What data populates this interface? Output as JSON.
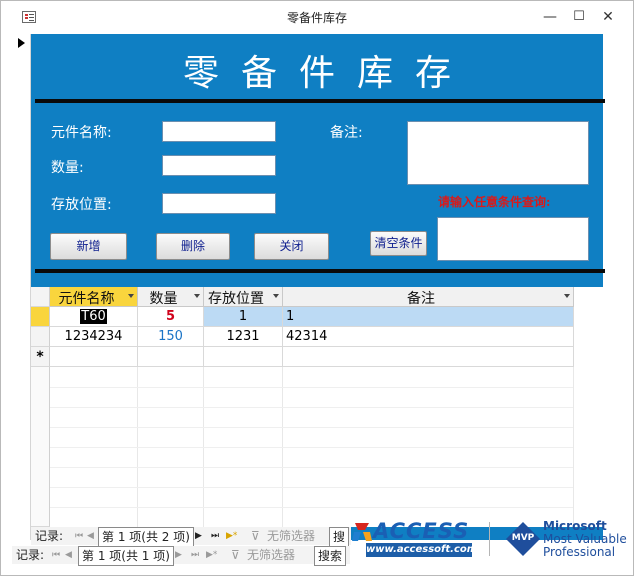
{
  "window": {
    "title": "零备件库存",
    "minimize": "—",
    "maximize": "☐",
    "close": "✕"
  },
  "form": {
    "heading": "零备件库存",
    "labels": {
      "name": "元件名称:",
      "quantity": "数量:",
      "location": "存放位置:",
      "remark": "备注:"
    },
    "inputs": {
      "name": "",
      "quantity": "",
      "location": "",
      "remark": "",
      "query": ""
    },
    "query_hint": "请输入任意条件查询:",
    "buttons": {
      "add": "新增",
      "delete": "删除",
      "close": "关闭",
      "clear": "清空条件"
    }
  },
  "datasheet": {
    "columns": [
      "元件名称",
      "数量",
      "存放位置",
      "备注"
    ],
    "rows": [
      {
        "name": "T60",
        "quantity": "5",
        "location": "1",
        "remark": "1"
      },
      {
        "name": "1234234",
        "quantity": "150",
        "location": "1231",
        "remark": "42314"
      }
    ],
    "new_row_marker": "*"
  },
  "subform_nav": {
    "label": "记录:",
    "first": "⏮",
    "prev": "◀",
    "position": "第 1 项(共 2 项)",
    "next": "▶",
    "last": "⏭",
    "new": "▶*",
    "filter": "无筛选器",
    "search": "搜"
  },
  "main_nav": {
    "label": "记录:",
    "first": "⏮",
    "prev": "◀",
    "position": "第 1 项(共 1 项)",
    "next": "▶",
    "last": "⏭",
    "new": "▶*",
    "filter": "无筛选器",
    "search": "搜索"
  },
  "logos": {
    "access_title": "ACCESS",
    "access_url": "www.accessoft.com",
    "mvp_badge": "MVP",
    "mvp_line1": "Microsoft",
    "mvp_line2": "Most Valuable",
    "mvp_line3": "Professional"
  },
  "colors": {
    "form_background": "#0f7fc3",
    "hint": "#d91a1a",
    "header_highlight": "#f9d53d",
    "quantity_first": "#d0021b",
    "quantity_second": "#1a74c6"
  }
}
